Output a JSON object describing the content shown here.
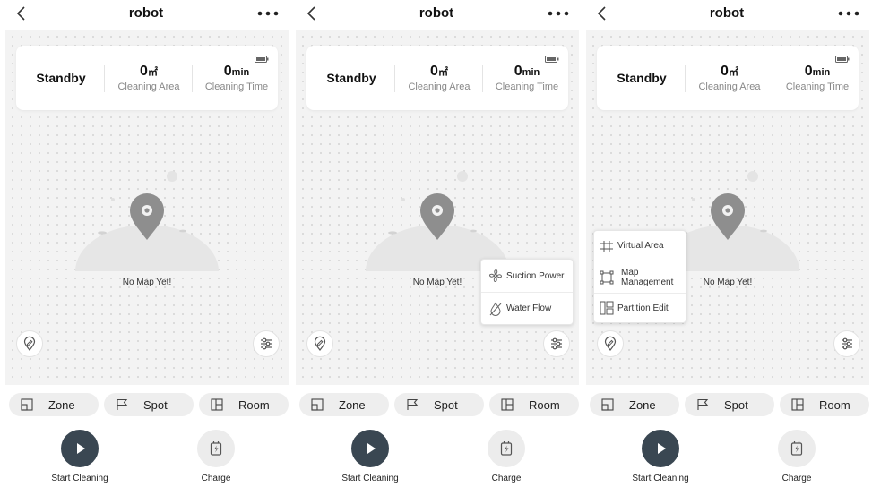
{
  "app": {
    "title": "robot"
  },
  "status": {
    "state": "Standby",
    "area_value": "0",
    "area_unit": "㎡",
    "area_label": "Cleaning Area",
    "time_value": "0",
    "time_unit": "min",
    "time_label": "Cleaning Time"
  },
  "map": {
    "empty_text": "No Map Yet!"
  },
  "modes": {
    "zone": "Zone",
    "spot": "Spot",
    "room": "Room"
  },
  "actions": {
    "start": "Start Cleaning",
    "charge": "Charge"
  },
  "settings_popover": {
    "suction": "Suction Power",
    "water": "Water Flow"
  },
  "map_popover": {
    "virtual": "Virtual Area",
    "map_mgmt_line1": "Map",
    "map_mgmt_line2": "Management",
    "partition": "Partition Edit"
  },
  "colors": {
    "accent_dark": "#3a4752",
    "map_bg": "#f3f3f3",
    "pin": "#8e8e8e"
  }
}
